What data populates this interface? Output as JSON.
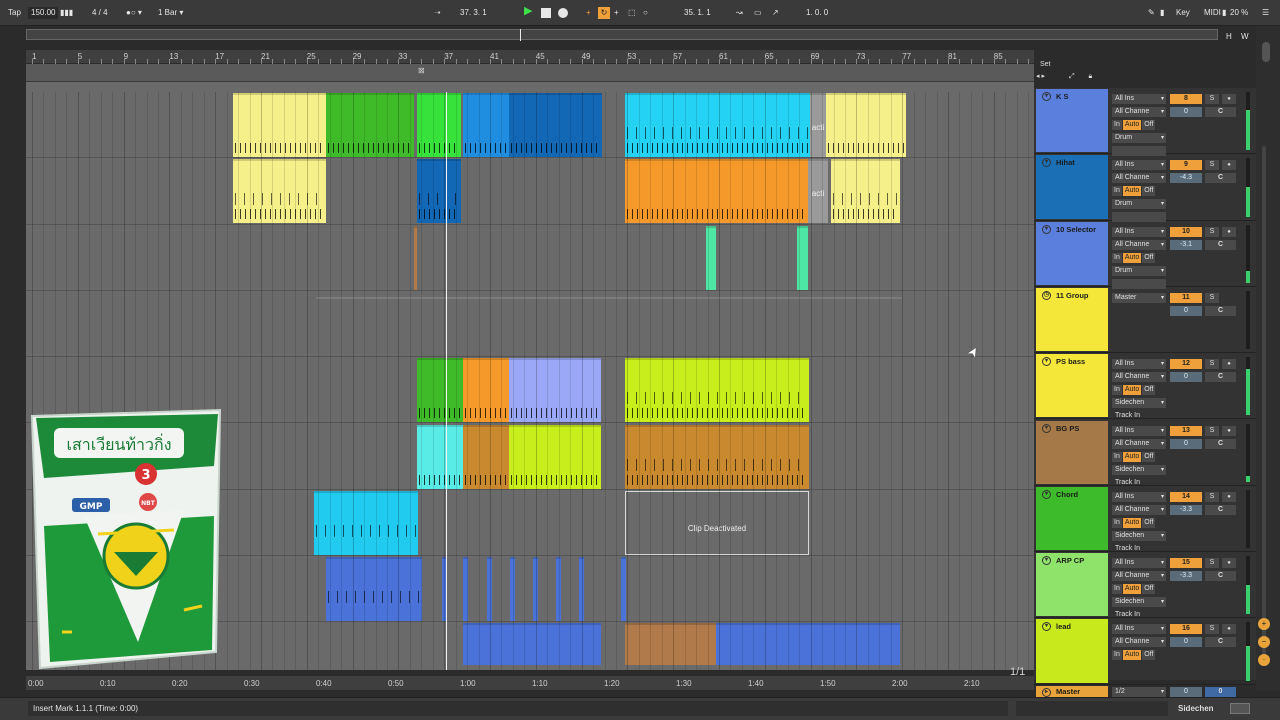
{
  "topbar": {
    "tap_label": "Tap",
    "tempo": "150.00",
    "time_signature": "4 / 4",
    "quantize": "1 Bar",
    "position": "37. 3. 1",
    "loop_start": "35. 1. 1",
    "loop_length": "1. 0. 0",
    "key_label": "Key",
    "midi_label": "MIDI",
    "cpu": "20 %",
    "h_label": "H",
    "w_label": "W"
  },
  "ruler": {
    "bars": [
      "1",
      "5",
      "9",
      "13",
      "17",
      "21",
      "25",
      "29",
      "33",
      "37",
      "41",
      "45",
      "49",
      "53",
      "57",
      "61",
      "65",
      "69",
      "73",
      "77",
      "81",
      "85"
    ]
  },
  "time_ruler": {
    "labels": [
      "0:00",
      "0:10",
      "0:20",
      "0:30",
      "0:40",
      "0:50",
      "1:00",
      "1:10",
      "1:20",
      "1:30",
      "1:40",
      "1:50",
      "2:00",
      "2:10"
    ]
  },
  "arrangement": {
    "deactivated_clip_label": "Clip Deactivated",
    "short_deact_label": "acti",
    "pager": "1/1"
  },
  "mixer": {
    "set_label": "Set",
    "tracks": [
      {
        "name": "K S",
        "color": "#5b7fdc",
        "input": "All Ins",
        "channel": "All Channe",
        "out": "Drum",
        "number": "8",
        "volume": "0",
        "pan": "C",
        "meter": 0.7,
        "kind": "drum"
      },
      {
        "name": "Hihat",
        "color": "#1a6fb5",
        "input": "All Ins",
        "channel": "All Channe",
        "out": "Drum",
        "number": "9",
        "volume": "-4.3",
        "pan": "C",
        "meter": 0.5,
        "kind": "drum"
      },
      {
        "name": "10 Selector",
        "color": "#5b7fdc",
        "input": "All Ins",
        "channel": "All Channe",
        "out": "Drum",
        "number": "10",
        "volume": "-3.1",
        "pan": "C",
        "meter": 0.2,
        "kind": "drum"
      },
      {
        "name": "11 Group",
        "color": "#f5e73a",
        "input": "Master",
        "number": "11",
        "volume": "0",
        "pan": "C",
        "meter": 0.0,
        "kind": "group"
      },
      {
        "name": "PS bass",
        "color": "#f5e73a",
        "input": "All Ins",
        "channel": "All Channe",
        "out": "Sidechen",
        "track_in": "Track In",
        "number": "12",
        "volume": "0",
        "pan": "C",
        "meter": 0.8,
        "kind": "synth"
      },
      {
        "name": "BG PS",
        "color": "#a57948",
        "input": "All Ins",
        "channel": "All Channe",
        "out": "Sidechen",
        "track_in": "Track In",
        "number": "13",
        "volume": "0",
        "pan": "C",
        "meter": 0.1,
        "kind": "synth"
      },
      {
        "name": "Chord",
        "color": "#3dbb2a",
        "input": "All Ins",
        "channel": "All Channe",
        "out": "Sidechen",
        "track_in": "Track In",
        "number": "14",
        "volume": "-3.3",
        "pan": "C",
        "meter": 0.0,
        "kind": "synth"
      },
      {
        "name": "ARP CP",
        "color": "#8fe36a",
        "input": "All Ins",
        "channel": "All Channe",
        "out": "Sidechen",
        "track_in": "Track In",
        "number": "15",
        "volume": "-3.3",
        "pan": "C",
        "meter": 0.5,
        "kind": "synth"
      },
      {
        "name": "lead",
        "color": "#c8ea1c",
        "input": "All Ins",
        "channel": "All Channe",
        "number": "16",
        "volume": "0",
        "pan": "C",
        "meter": 0.6,
        "kind": "lead"
      }
    ],
    "master": {
      "name": "Master",
      "color": "#e8a43a",
      "input": "1/2",
      "volume": "0",
      "volume2": "0"
    },
    "in_label": "In",
    "auto_label": "Auto",
    "off_label": "Off",
    "solo_label": "S"
  },
  "status": {
    "text": "Insert Mark 1.1.1 (Time: 0:00)",
    "sidechain_label": "Sidechen"
  },
  "product": {
    "label_text": "เสาเวียนท้าวกิ่ง",
    "brand_number": "3",
    "gmp_label": "GMP",
    "nbt_label": "NBT"
  },
  "colors": {
    "yellow": "#f5f08a",
    "green": "#3fbb2a",
    "bright_green": "#37e33a",
    "blue": "#1f8ee0",
    "dark_blue": "#1368b5",
    "cyan": "#24d2f3",
    "orange": "#f59a2a",
    "mint": "#4ee6a4",
    "lime": "#c8ee1c",
    "periwinkle": "#9aa8f7",
    "teal": "#59ece6",
    "brown": "#c9892f",
    "sky": "#20cbef",
    "royal": "#4a72d9",
    "tan": "#b07a4a"
  }
}
